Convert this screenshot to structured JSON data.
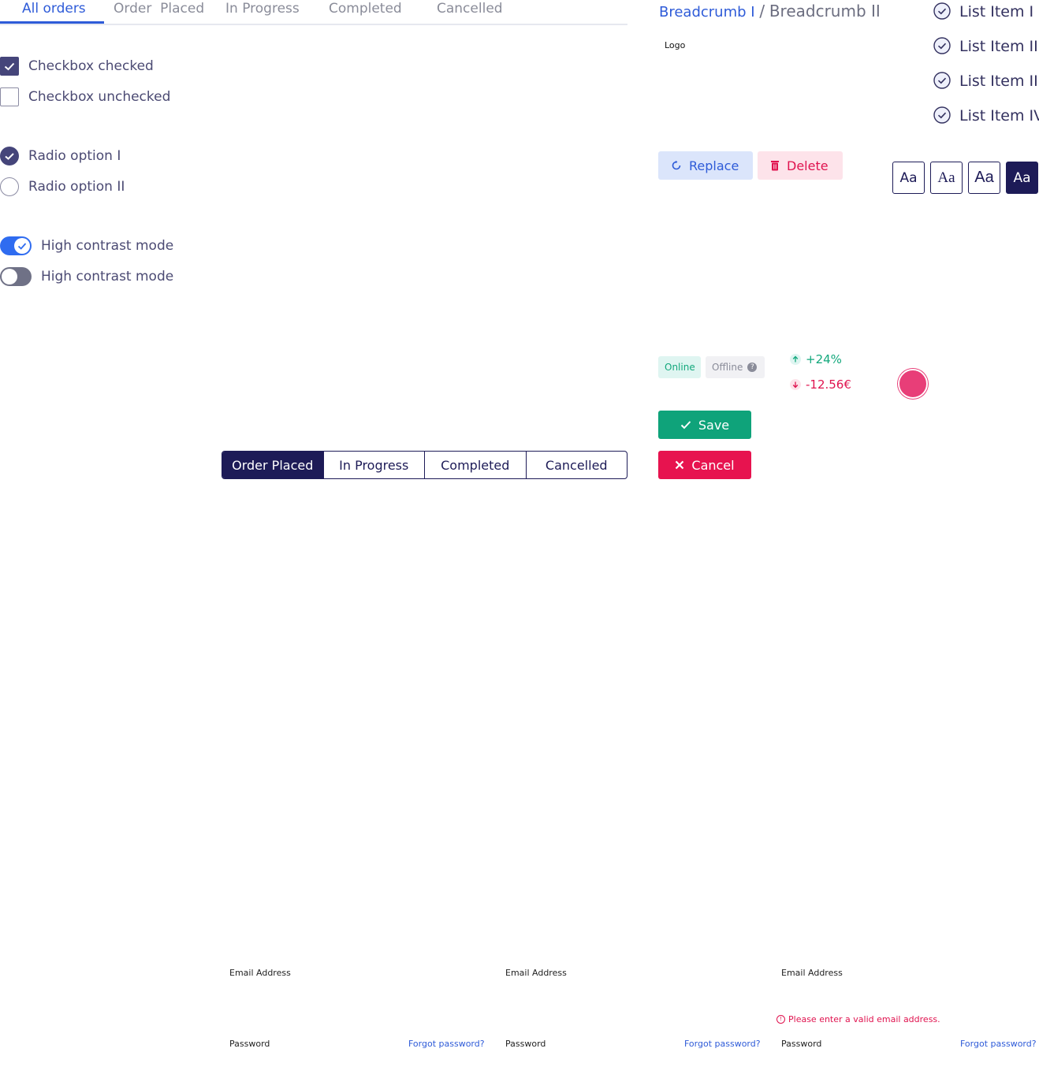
{
  "tabs": {
    "items": [
      "All orders",
      "Order  Placed",
      "In Progress",
      "Completed",
      "Cancelled"
    ]
  },
  "checkboxes": {
    "checked_label": "Checkbox checked",
    "unchecked_label": "Checkbox unchecked"
  },
  "radios": {
    "option1_label": "Radio option I",
    "option2_label": "Radio option II"
  },
  "toggles": {
    "on_label": "High contrast mode",
    "off_label": "High contrast mode"
  },
  "segmented": {
    "items": [
      "Order Placed",
      "In Progress",
      "Completed",
      "Cancelled"
    ],
    "selected": "Order Placed"
  },
  "breadcrumb": {
    "item1": "Breadcrumb I",
    "separator": "/",
    "item2": "Breadcrumb II"
  },
  "logo_text": "Logo",
  "checklist": {
    "items": [
      "List Item I",
      "List Item II",
      "List Item III",
      "List Item IV"
    ]
  },
  "actions": {
    "replace_label": "Replace",
    "delete_label": "Delete"
  },
  "font_sizes": {
    "items": [
      "Aa",
      "Aa",
      "Aa",
      "Aa"
    ],
    "selected_index": 3
  },
  "status": {
    "online": "Online",
    "offline": "Offline",
    "trend_up": "+24%",
    "trend_down": "-12.56€"
  },
  "buttons": {
    "save_label": "Save",
    "cancel_label": "Cancel"
  },
  "forms": [
    {
      "email_label": "Email Address",
      "password_label": "Password",
      "forgot_link": "Forgot password?"
    },
    {
      "email_label": "Email Address",
      "password_label": "Password",
      "forgot_link": "Forgot password?"
    },
    {
      "email_label": "Email Address",
      "password_label": "Password",
      "forgot_link": "Forgot password?",
      "error": "Please enter a valid email address."
    }
  ],
  "colors": {
    "primary": "#2e5bd8",
    "navy": "#1d1b57",
    "success": "#0fa37a",
    "danger": "#e7134f",
    "accent_pink": "#e83e78"
  }
}
